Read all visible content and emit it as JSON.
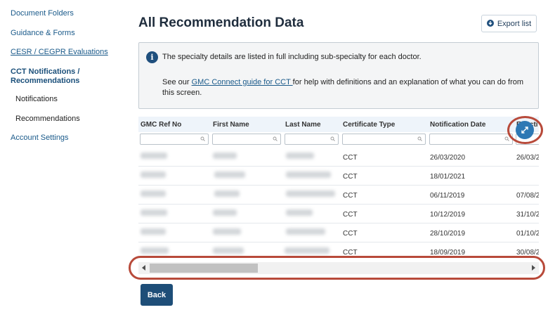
{
  "sidebar": {
    "document_folders": "Document Folders",
    "guidance_forms": "Guidance & Forms",
    "cesr_evaluations": "CESR / CEGPR Evaluations",
    "cct_section": "CCT Notifications / Recommendations",
    "notifications": "Notifications",
    "recommendations": "Recommendations",
    "account_settings": "Account Settings"
  },
  "header": {
    "title": "All Recommendation Data",
    "export_label": "Export list"
  },
  "info": {
    "line1": "The specialty details are listed in full including sub-specialty for each doctor.",
    "line2_prefix": "See our ",
    "line2_link": "GMC Connect guide for CCT ",
    "line2_suffix": " for help with definitions and an explanation of what you can do from this screen."
  },
  "table": {
    "columns": [
      "GMC Ref No",
      "First Name",
      "Last Name",
      "Certificate Type",
      "Notification Date",
      "Effecti"
    ],
    "rows": [
      {
        "certificate_type": "CCT",
        "notification_date": "26/03/2020",
        "effective_date": "26/03/2"
      },
      {
        "certificate_type": "CCT",
        "notification_date": "18/01/2021",
        "effective_date": ""
      },
      {
        "certificate_type": "CCT",
        "notification_date": "06/11/2019",
        "effective_date": "07/08/2"
      },
      {
        "certificate_type": "CCT",
        "notification_date": "10/12/2019",
        "effective_date": "31/10/2"
      },
      {
        "certificate_type": "CCT",
        "notification_date": "28/10/2019",
        "effective_date": "01/10/2"
      },
      {
        "certificate_type": "CCT",
        "notification_date": "18/09/2019",
        "effective_date": "30/08/2"
      }
    ]
  },
  "footer": {
    "back_label": "Back"
  },
  "colors": {
    "primary": "#1e4e78",
    "accent": "#2d78b4",
    "highlight_ring": "#b84a3a",
    "link": "#1a5a8a"
  },
  "icons": [
    "info-icon",
    "download-circle-icon",
    "search-icon",
    "expand-icon",
    "scroll-left-icon",
    "scroll-right-icon"
  ]
}
